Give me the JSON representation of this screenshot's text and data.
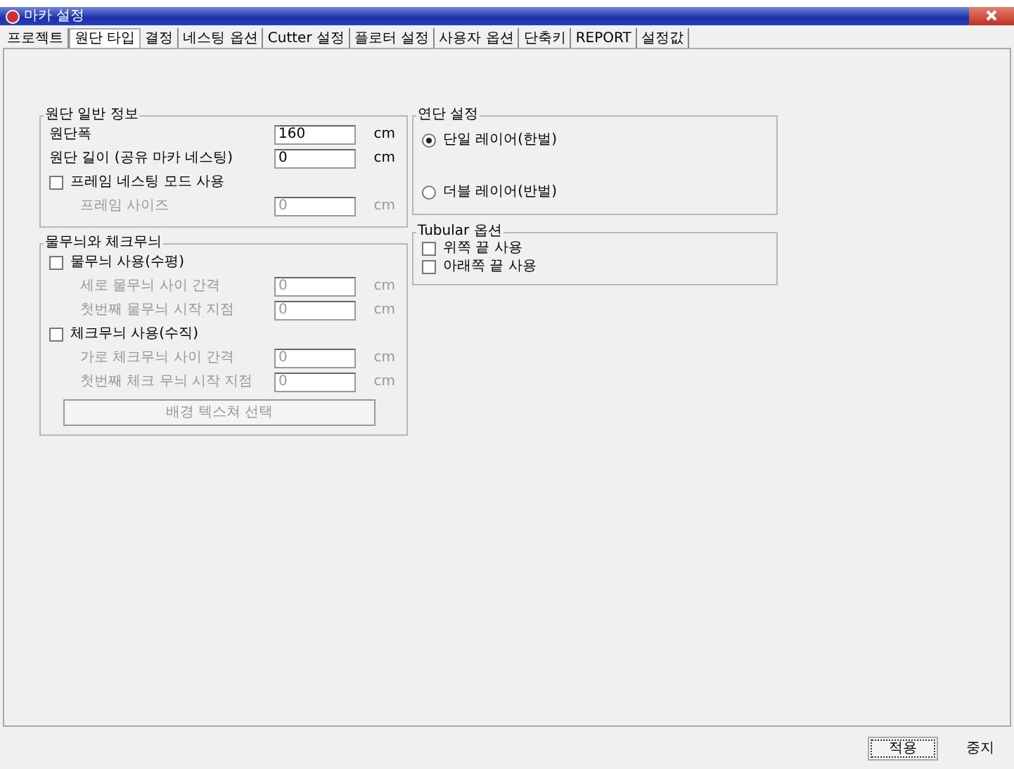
{
  "window": {
    "title": "마카 설정"
  },
  "tabs": [
    {
      "label": "프로젝트",
      "selected": false
    },
    {
      "label": "원단 타입",
      "selected": true
    },
    {
      "label": "결정",
      "selected": false
    },
    {
      "label": "네스팅 옵션",
      "selected": false
    },
    {
      "label": "Cutter 설정",
      "selected": false
    },
    {
      "label": "플로터 설정",
      "selected": false
    },
    {
      "label": "사용자 옵션",
      "selected": false
    },
    {
      "label": "단축키",
      "selected": false
    },
    {
      "label": "REPORT",
      "selected": false
    },
    {
      "label": "설정값",
      "selected": false
    }
  ],
  "left_groups": [
    {
      "title": "원단 일반 정보",
      "rows": [
        {
          "kind": "field",
          "label": "원단폭",
          "value": "160",
          "unit": "cm",
          "disabled": false,
          "indent": false
        },
        {
          "kind": "field",
          "label": "원단 길이 (공유 마카 네스팅)",
          "value": "0",
          "unit": "cm",
          "disabled": false,
          "indent": false
        },
        {
          "kind": "checkbox",
          "label": "프레임 네스팅 모드 사용",
          "checked": false
        },
        {
          "kind": "field",
          "label": "프레임 사이즈",
          "value": "0",
          "unit": "cm",
          "disabled": true,
          "indent": true
        }
      ]
    },
    {
      "title": "물무늬와 체크무늬",
      "rows": [
        {
          "kind": "checkbox",
          "label": "물무늬 사용(수평)",
          "checked": false
        },
        {
          "kind": "field",
          "label": "세로 물무늬 사이 간격",
          "value": "0",
          "unit": "cm",
          "disabled": true,
          "indent": true
        },
        {
          "kind": "field",
          "label": "첫번째 물무늬 시작 지점",
          "value": "0",
          "unit": "cm",
          "disabled": true,
          "indent": true
        },
        {
          "kind": "checkbox",
          "label": "체크무늬 사용(수직)",
          "checked": false
        },
        {
          "kind": "field",
          "label": "가로 체크무늬 사이 간격",
          "value": "0",
          "unit": "cm",
          "disabled": true,
          "indent": true
        },
        {
          "kind": "field",
          "label": "첫번째 체크 무늬 시작 지점",
          "value": "0",
          "unit": "cm",
          "disabled": true,
          "indent": true
        },
        {
          "kind": "button",
          "label": "배경 텍스쳐 선택",
          "disabled": true
        }
      ]
    }
  ],
  "spreading": {
    "title": "연단 설정",
    "options": [
      {
        "label": "단일 레이어(한벌)",
        "selected": true
      },
      {
        "label": "더블 레이어(반벌)",
        "selected": false
      }
    ]
  },
  "tubular": {
    "title": "Tubular 옵션",
    "options": [
      {
        "label": "위쪽 끝 사용",
        "checked": false
      },
      {
        "label": "아래쪽 끝 사용",
        "checked": false
      }
    ]
  },
  "buttons": [
    {
      "label": "적용",
      "focused": true
    },
    {
      "label": "중지",
      "focused": false
    }
  ]
}
